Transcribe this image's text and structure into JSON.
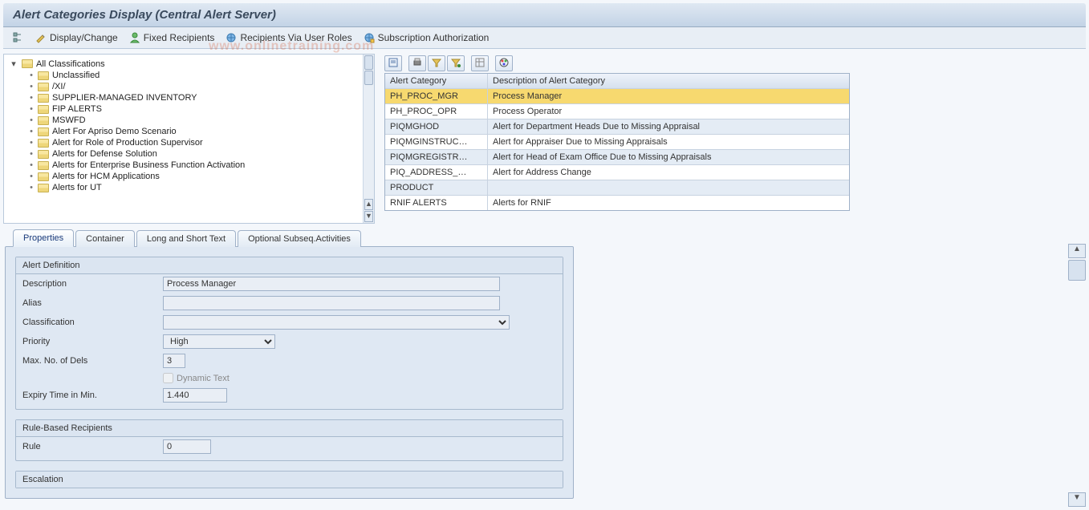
{
  "title": "Alert Categories Display (Central Alert Server)",
  "toolbar": {
    "items": [
      {
        "label": "",
        "icon": "tree"
      },
      {
        "label": "Display/Change",
        "icon": "pencil"
      },
      {
        "label": "Fixed Recipients",
        "icon": "user-green"
      },
      {
        "label": "Recipients Via User Roles",
        "icon": "globe"
      },
      {
        "label": "Subscription Authorization",
        "icon": "globe-plus"
      }
    ]
  },
  "watermark_text": "www.onlinetraining.com",
  "tree": {
    "root": "All Classifications",
    "items": [
      "Unclassified",
      "/XI/",
      "SUPPLIER-MANAGED INVENTORY",
      "FIP ALERTS",
      "MSWFD",
      "Alert For Apriso Demo Scenario",
      "Alert for Role of Production Supervisor",
      "Alerts for Defense Solution",
      "Alerts for Enterprise Business Function Activation",
      "Alerts for HCM Applications",
      "Alerts for UT"
    ]
  },
  "grid": {
    "headers": {
      "cat": "Alert Category",
      "desc": "Description of Alert Category"
    },
    "rows": [
      {
        "cat": "PH_PROC_MGR",
        "desc": "Process Manager",
        "sel": true,
        "alt": true
      },
      {
        "cat": "PH_PROC_OPR",
        "desc": "Process Operator",
        "alt": false
      },
      {
        "cat": "PIQMGHOD",
        "desc": "Alert for Department Heads Due to Missing Appraisal",
        "alt": true
      },
      {
        "cat": "PIQMGINSTRUC…",
        "desc": "Alert for Appraiser Due to Missing Appraisals",
        "alt": false
      },
      {
        "cat": "PIQMGREGISTR…",
        "desc": "Alert for Head of Exam Office Due to Missing Appraisals",
        "alt": true
      },
      {
        "cat": "PIQ_ADDRESS_…",
        "desc": "Alert for Address Change",
        "alt": false
      },
      {
        "cat": "PRODUCT",
        "desc": "",
        "alt": true
      },
      {
        "cat": "RNIF ALERTS",
        "desc": "Alerts for RNIF",
        "alt": false
      }
    ]
  },
  "tabs": [
    {
      "label": "Properties",
      "active": true
    },
    {
      "label": "Container",
      "active": false
    },
    {
      "label": "Long and Short Text",
      "active": false
    },
    {
      "label": "Optional Subseq.Activities",
      "active": false
    }
  ],
  "form": {
    "group1_title": "Alert Definition",
    "description_label": "Description",
    "description_value": "Process Manager",
    "alias_label": "Alias",
    "alias_value": "",
    "classification_label": "Classification",
    "classification_value": "",
    "priority_label": "Priority",
    "priority_value": "High",
    "maxdels_label": "Max. No. of Dels",
    "maxdels_value": "3",
    "dyntext_label": "Dynamic Text",
    "expiry_label": "Expiry Time in Min.",
    "expiry_value": "1.440",
    "group2_title": "Rule-Based Recipients",
    "rule_label": "Rule",
    "rule_value": "0",
    "group3_title": "Escalation"
  }
}
